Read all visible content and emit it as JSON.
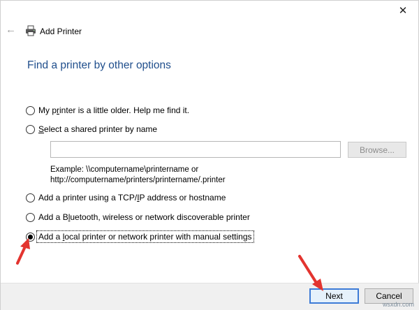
{
  "window": {
    "title": "Add Printer",
    "close_glyph": "✕",
    "back_glyph": "←"
  },
  "heading": "Find a printer by other options",
  "options": [
    {
      "pre": "My p",
      "ul": "r",
      "post": "inter is a little older. Help me find it.",
      "checked": false
    },
    {
      "pre": "",
      "ul": "S",
      "post": "elect a shared printer by name",
      "checked": true
    },
    {
      "pre": "Add a printer using a TCP/",
      "ul": "I",
      "post": "P address or hostname",
      "checked": false
    },
    {
      "pre": "Add a B",
      "ul": "l",
      "post": "uetooth, wireless or network discoverable printer",
      "checked": false
    },
    {
      "pre": "Add a ",
      "ul": "l",
      "post": "ocal printer or network printer with manual settings",
      "checked": true
    }
  ],
  "shared_printer": {
    "input_value": "",
    "browse_label": "Browse...",
    "example_line1": "Example: \\\\computername\\printername or",
    "example_line2": "http://computername/printers/printername/.printer"
  },
  "footer": {
    "next_label": "Next",
    "cancel_label": "Cancel"
  },
  "icons": {
    "printer": "printer-icon",
    "back": "back-arrow-icon",
    "close": "close-icon"
  },
  "colors": {
    "heading": "#1f4e8c",
    "annotation_arrow": "#e3342f",
    "footer_bg": "#f0f0f0",
    "next_border": "#3d7bd6"
  },
  "watermark": "wsxdn.com"
}
